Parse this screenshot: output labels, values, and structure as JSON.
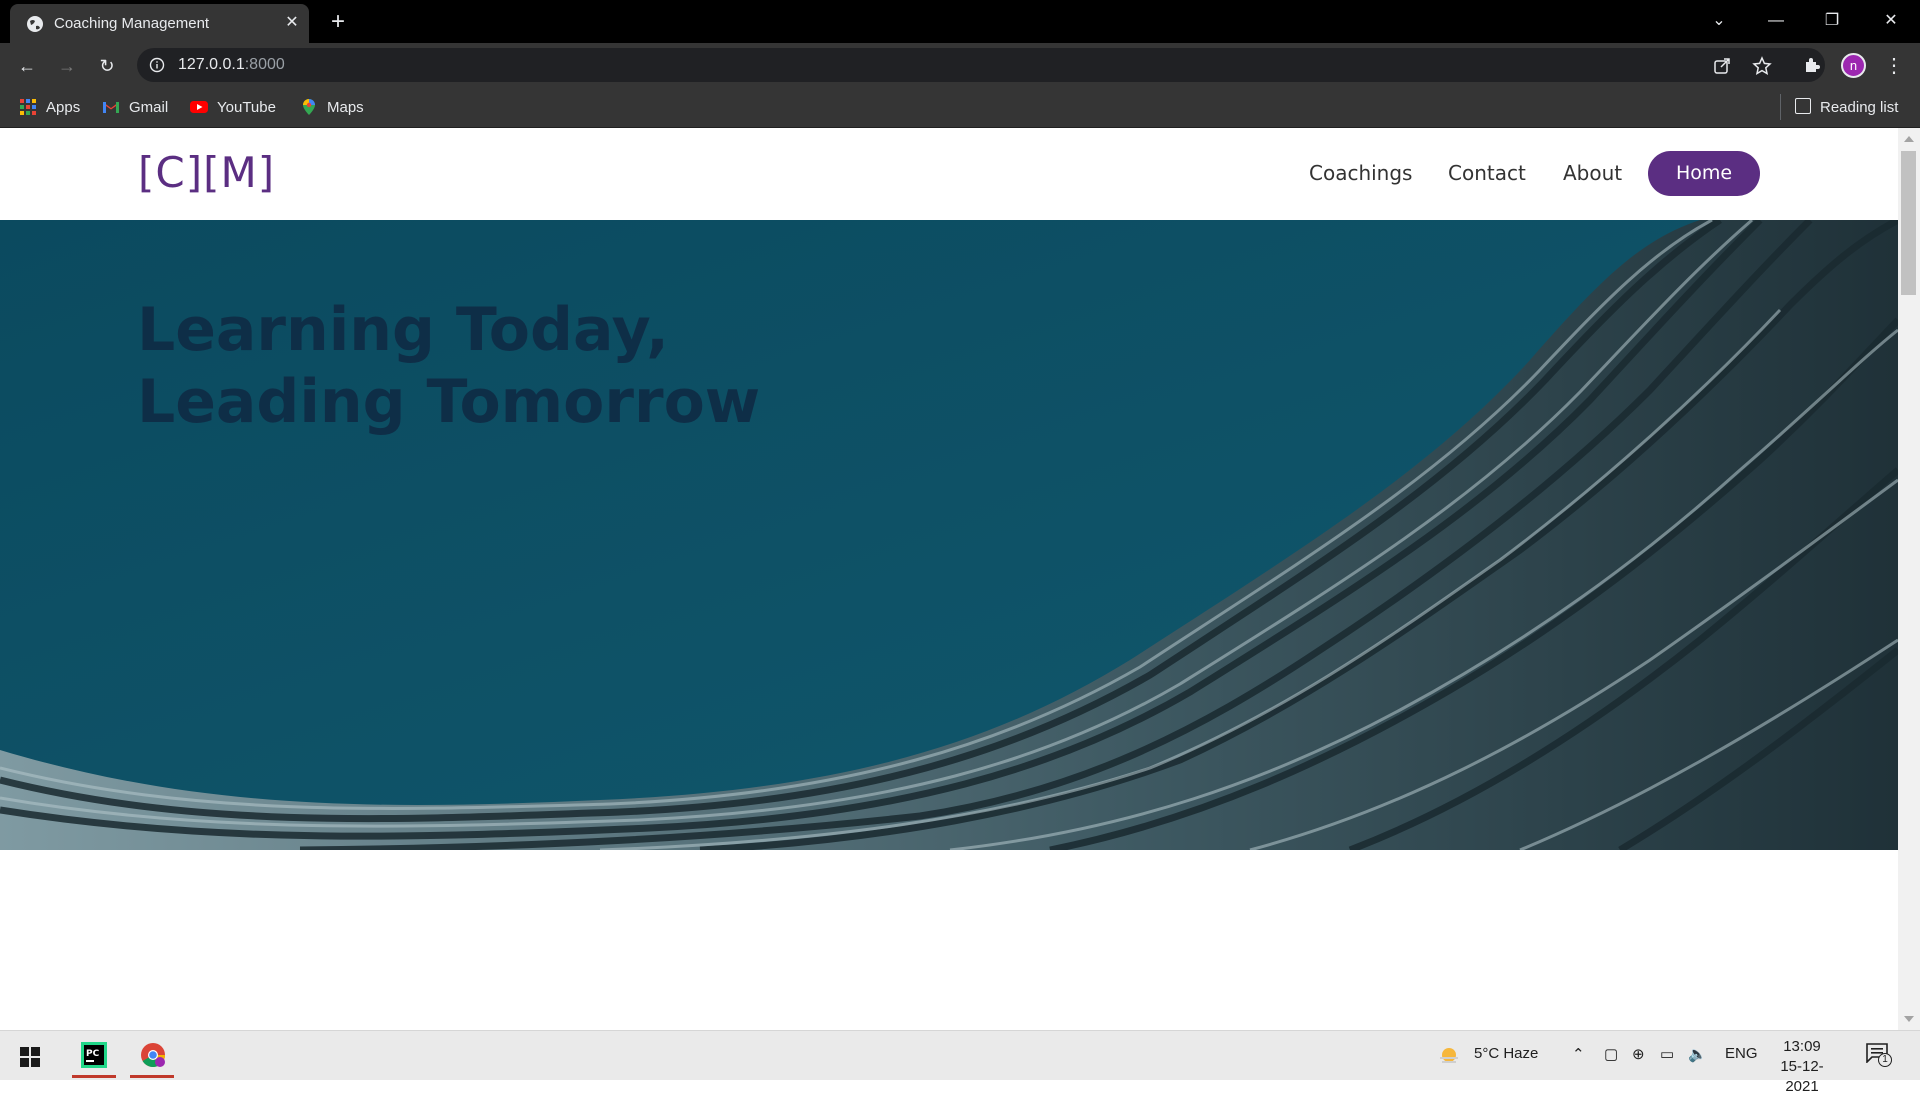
{
  "browser": {
    "tab_title": "Coaching Management",
    "url_host": "127.0.0.1",
    "url_port": ":8000",
    "profile_initial": "n",
    "bookmarks": [
      {
        "label": "Apps",
        "icon": "apps-grid-icon"
      },
      {
        "label": "Gmail",
        "icon": "gmail-icon"
      },
      {
        "label": "YouTube",
        "icon": "youtube-icon"
      },
      {
        "label": "Maps",
        "icon": "maps-icon"
      }
    ],
    "reading_list": "Reading list"
  },
  "site": {
    "logo": "[C][M]",
    "nav": [
      "Coachings",
      "Contact",
      "About"
    ],
    "home_button": "Home",
    "hero": {
      "line1": "Learning Today,",
      "line2": "Leading Tomorrow"
    },
    "colors": {
      "brand": "#5b2e82",
      "hero_bg": "#0e4f63",
      "hero_text": "#0f2c45"
    }
  },
  "taskbar": {
    "weather": "5°C  Haze",
    "language": "ENG",
    "time": "13:09",
    "date": "15-12-2021",
    "notifications": "1"
  }
}
